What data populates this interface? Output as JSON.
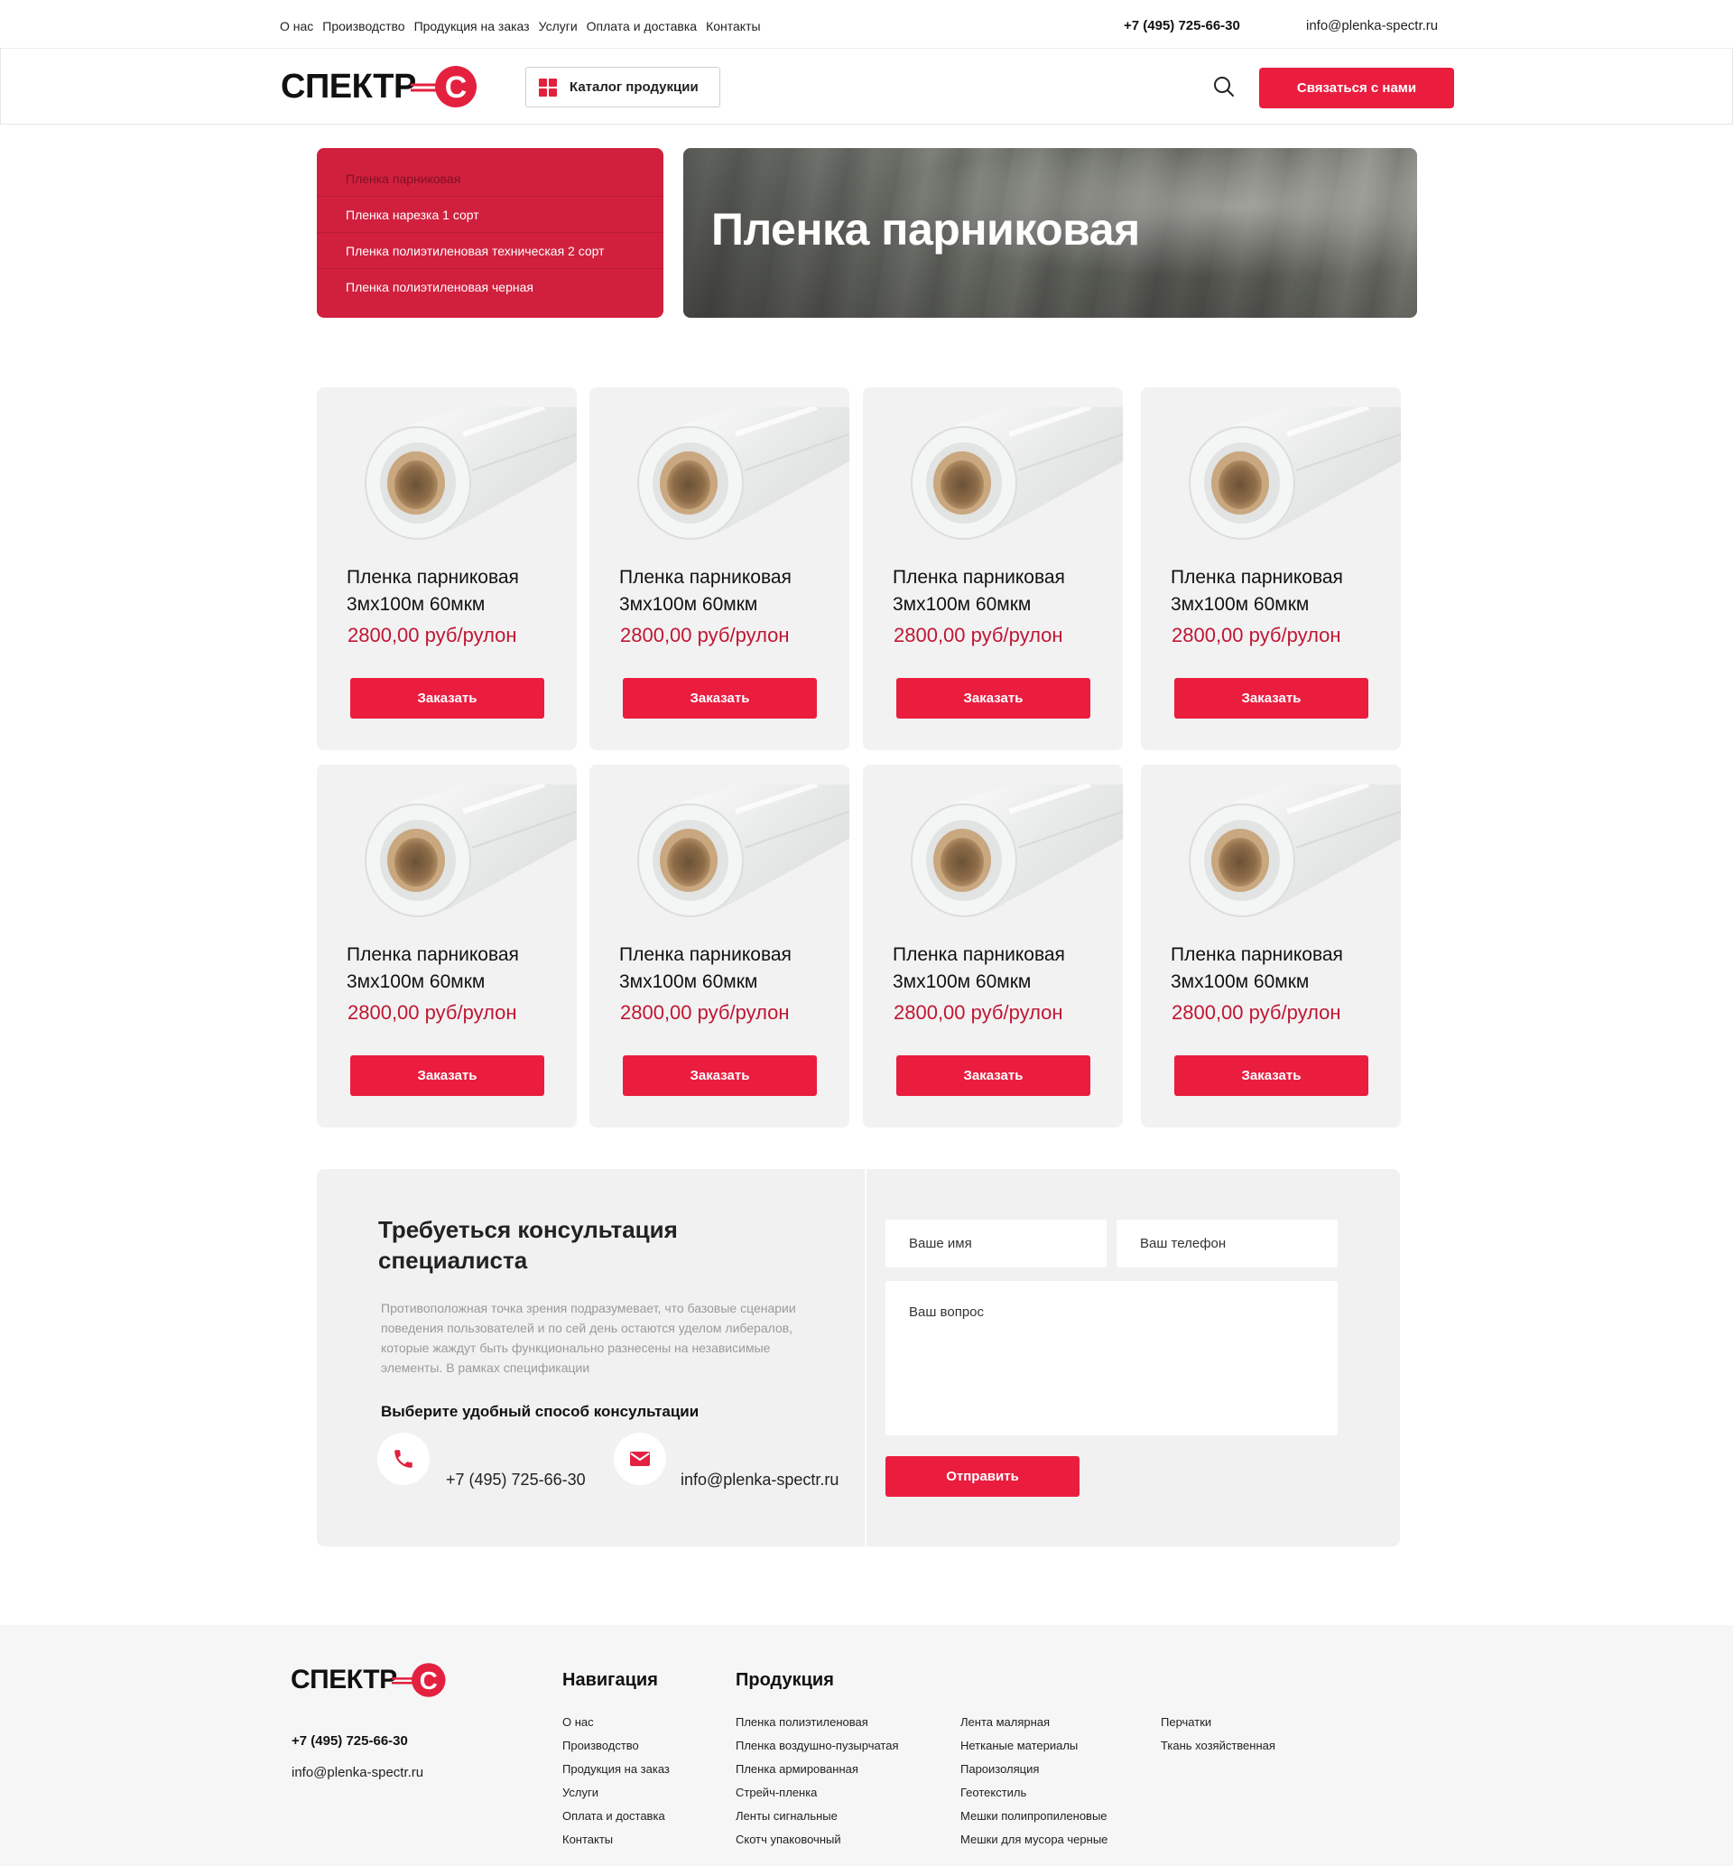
{
  "topbar": {
    "nav": [
      "О нас",
      "Производство",
      "Продукция на заказ",
      "Услуги",
      "Оплата и доставка",
      "Контакты"
    ],
    "phone": "+7 (495) 725-66-30",
    "email": "info@plenka-spectr.ru"
  },
  "header": {
    "logo_text": "СПЕКТР",
    "logo_letter": "С",
    "catalog_label": "Каталог продукции",
    "contact_label": "Связаться с нами"
  },
  "hero": {
    "menu": [
      "Пленка парниковая",
      "Пленка нарезка 1 сорт",
      "Пленка полиэтиленовая техническая 2 сорт",
      "Пленка полиэтиленовая черная"
    ],
    "title": "Пленка парниковая"
  },
  "products": [
    {
      "name": "Пленка парниковая 3мх100м 60мкм",
      "price": "2800,00 руб/рулон",
      "button": "Заказать"
    },
    {
      "name": "Пленка парниковая 3мх100м 60мкм",
      "price": "2800,00 руб/рулон",
      "button": "Заказать"
    },
    {
      "name": "Пленка парниковая 3мх100м 60мкм",
      "price": "2800,00 руб/рулон",
      "button": "Заказать"
    },
    {
      "name": "Пленка парниковая 3мх100м 60мкм",
      "price": "2800,00 руб/рулон",
      "button": "Заказать"
    },
    {
      "name": "Пленка парниковая 3мх100м 60мкм",
      "price": "2800,00 руб/рулон",
      "button": "Заказать"
    },
    {
      "name": "Пленка парниковая 3мх100м 60мкм",
      "price": "2800,00 руб/рулон",
      "button": "Заказать"
    },
    {
      "name": "Пленка парниковая 3мх100м 60мкм",
      "price": "2800,00 руб/рулон",
      "button": "Заказать"
    },
    {
      "name": "Пленка парниковая 3мх100м 60мкм",
      "price": "2800,00 руб/рулон",
      "button": "Заказать"
    }
  ],
  "consult": {
    "title": "Требуеться консультация специалиста",
    "text": "Противоположная точка зрения подразумевает, что базовые сценарии поведения пользователей и по сей день остаются уделом либералов, которые жаждут быть функционально разнесены на независимые элементы. В рамках спецификации",
    "subtitle": "Выберите удобный способ консультации",
    "phone": "+7 (495) 725-66-30",
    "email": "info@plenka-spectr.ru",
    "name_placeholder": "Ваше имя",
    "phone_placeholder": "Ваш телефон",
    "question_placeholder": "Ваш вопрос",
    "send_label": "Отправить"
  },
  "footer": {
    "phone": "+7 (495) 725-66-30",
    "email": "info@plenka-spectr.ru",
    "nav_title": "Навигация",
    "nav": [
      "О нас",
      "Производство",
      "Продукция на заказ",
      "Услуги",
      "Оплата и доставка",
      "Контакты"
    ],
    "products_title": "Продукция",
    "products_col1": [
      "Пленка полиэтиленовая",
      "Пленка воздушно-пузырчатая",
      "Пленка армированная",
      "Стрейч-пленка",
      "Ленты сигнальные",
      "Скотч упаковочный"
    ],
    "products_col2": [
      "Лента малярная",
      "Нетканые материалы",
      "Пароизоляция",
      "Геотекстиль",
      "Мешки полипропиленовые",
      "Мешки для мусора черные"
    ],
    "products_col3": [
      "Перчатки",
      "Ткань хозяйственная"
    ]
  },
  "colors": {
    "accent": "#ea1d3f",
    "menu_bg": "#d1203e",
    "price": "#c01633",
    "card_bg": "#f2f2f2"
  }
}
